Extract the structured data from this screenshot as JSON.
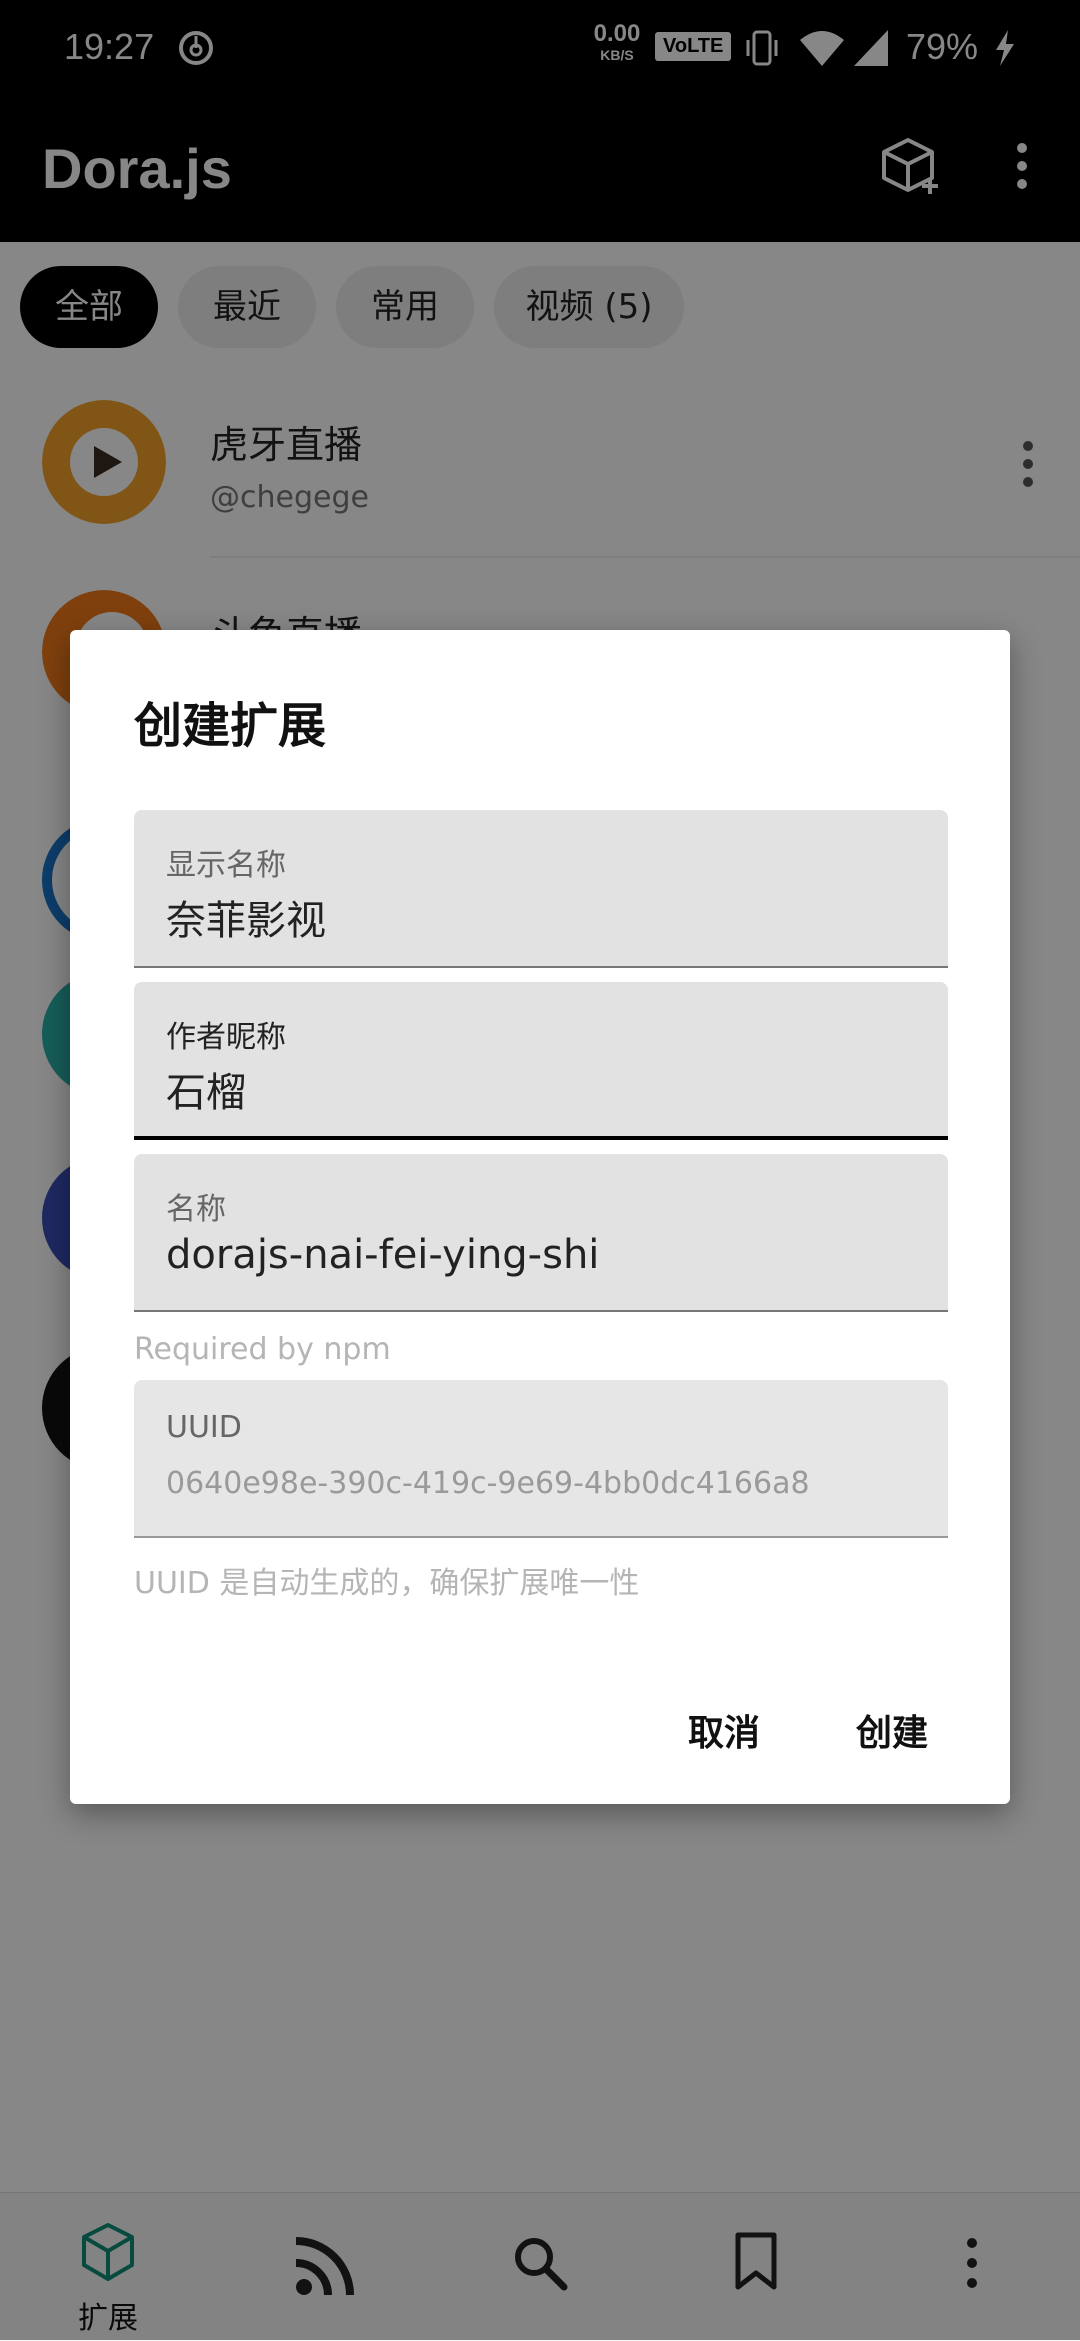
{
  "status_bar": {
    "time": "19:27",
    "net_speed_value": "0.00",
    "net_speed_unit": "KB/S",
    "volte": "VoLTE",
    "battery": "79%"
  },
  "app_bar": {
    "title": "Dora.js"
  },
  "chips": [
    "全部",
    "最近",
    "常用",
    "视频 (5)"
  ],
  "list": [
    {
      "title": "虎牙直播",
      "subtitle": "@chegege"
    },
    {
      "title": "斗鱼直播",
      "subtitle": ""
    }
  ],
  "dialog": {
    "title": "创建扩展",
    "fields": [
      {
        "label": "显示名称",
        "value": "奈菲影视"
      },
      {
        "label": "作者昵称",
        "value": "石榴"
      },
      {
        "label": "名称",
        "value": "dorajs-nai-fei-ying-shi"
      },
      {
        "label": "UUID",
        "value": "0640e98e-390c-419c-9e69-4bb0dc4166a8"
      }
    ],
    "name_helper": "Required by npm",
    "uuid_helper": "UUID 是自动生成的，确保扩展唯一性",
    "cancel_label": "取消",
    "create_label": "创建"
  },
  "bottom_nav": {
    "extensions_label": "扩展"
  },
  "colors": {
    "app_bar": "#000000",
    "chip_active": "#000000",
    "chip_inactive": "#eeeeee",
    "field_bg": "#e2e2e2",
    "huya_orange": "#f2a12a",
    "douyu_orange": "#f07a1a"
  },
  "icons": {
    "status": [
      "netease-music-icon",
      "vibrate-icon",
      "wifi-icon",
      "signal-icon",
      "charging-icon"
    ],
    "app_bar": [
      "cube-add-icon",
      "more-vert-icon"
    ],
    "nav": [
      "cube-icon",
      "rss-icon",
      "search-icon",
      "bookmark-icon",
      "more-vert-icon"
    ]
  }
}
